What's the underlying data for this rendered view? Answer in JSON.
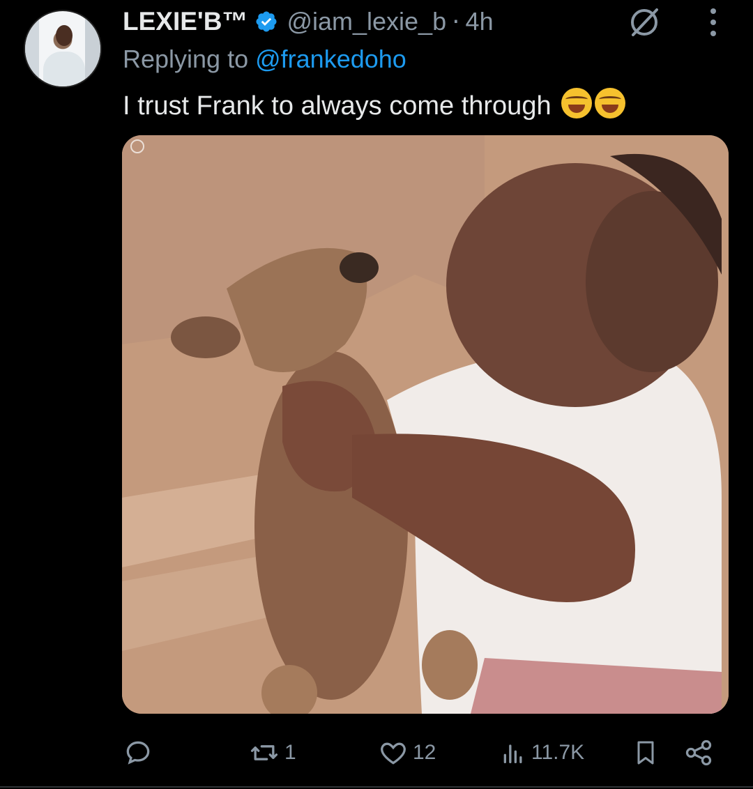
{
  "tweet": {
    "display_name": "LEXIE'B™",
    "handle": "@iam_lexie_b",
    "separator": "·",
    "time": "4h",
    "replying_prefix": "Replying to",
    "replying_to": "@frankedoho",
    "text": "I trust Frank to always come through",
    "emojis": [
      "face-with-tears-of-joy-emoji",
      "rolling-on-floor-laughing-emoji"
    ]
  },
  "actions": {
    "reply_count": "",
    "retweet_count": "1",
    "like_count": "12",
    "views_count": "11.7K"
  },
  "colors": {
    "background": "#000000",
    "primary_text": "#e7e9ea",
    "secondary_text": "#8b98a5",
    "link": "#1d9bf0",
    "verified": "#1d9bf0"
  },
  "icons": {
    "verified": "verified-badge-icon",
    "mute": "mute-icon",
    "more": "more-vertical-icon",
    "reply": "reply-icon",
    "retweet": "retweet-icon",
    "like": "heart-icon",
    "views": "views-icon",
    "bookmark": "bookmark-icon",
    "share": "share-icon"
  }
}
